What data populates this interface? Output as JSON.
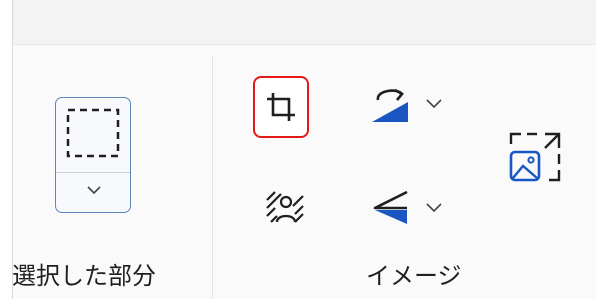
{
  "groups": {
    "selection": {
      "label": "選択した部分"
    },
    "image": {
      "label": "イメージ"
    }
  },
  "icons": {
    "select": "dashed-rectangle-select-icon",
    "crop": "crop-icon",
    "rotate": "rotate-icon",
    "flip": "flip-icon",
    "remove_background": "remove-background-icon",
    "resize": "resize-image-icon"
  },
  "colors": {
    "accent": "#1a56c2",
    "highlight_border": "#e61919",
    "select_border": "#5b87b8"
  }
}
